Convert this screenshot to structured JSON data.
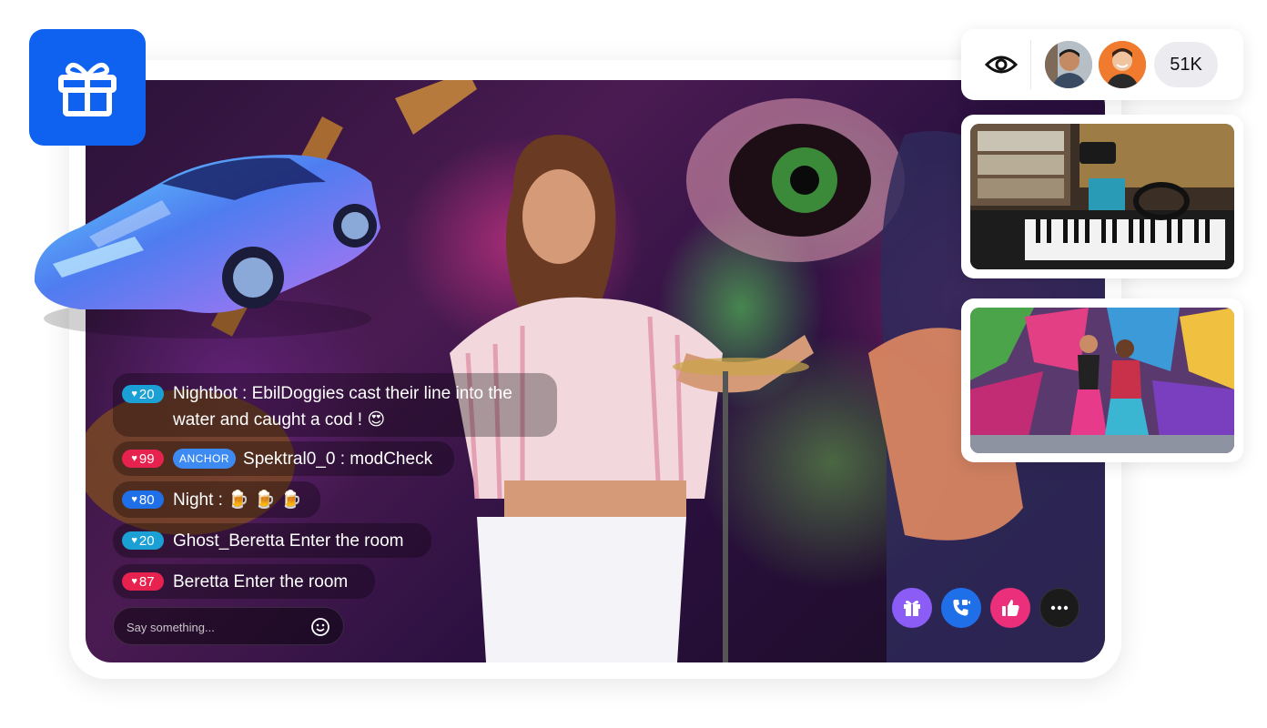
{
  "chat": {
    "messages": [
      {
        "level": "20",
        "level_color": "#1aa0d4",
        "line1": "Nightbot : EbilDoggies cast their line into the",
        "line2": "water and caught a cod ! 😍"
      },
      {
        "level": "99",
        "level_color": "#e8224e",
        "tag": "ANCHOR",
        "text": "Spektral0_0 : modCheck"
      },
      {
        "level": "80",
        "level_color": "#1f6fe8",
        "text": "Night : 🍺 🍺 🍺"
      },
      {
        "level": "20",
        "level_color": "#1aa0d4",
        "text": "Ghost_Beretta Enter the room"
      },
      {
        "level": "87",
        "level_color": "#e8224e",
        "text": "Beretta Enter the room"
      }
    ],
    "input_placeholder": "Say something..."
  },
  "viewers": {
    "count": "51K"
  },
  "icons": {
    "gift_badge": "gift-icon",
    "viewers": "eye-icon",
    "emoji": "smiley-icon",
    "gem": "diamond-icon",
    "actions": [
      "gift-icon",
      "video-call-icon",
      "thumbs-up-icon",
      "more-icon"
    ]
  },
  "colors": {
    "brand_blue": "#0f62f0",
    "gift_button": "#8b5cf6",
    "call_button": "#1f6fe8",
    "like_button": "#ec2f7b",
    "more_button": "#1b1b1b"
  }
}
